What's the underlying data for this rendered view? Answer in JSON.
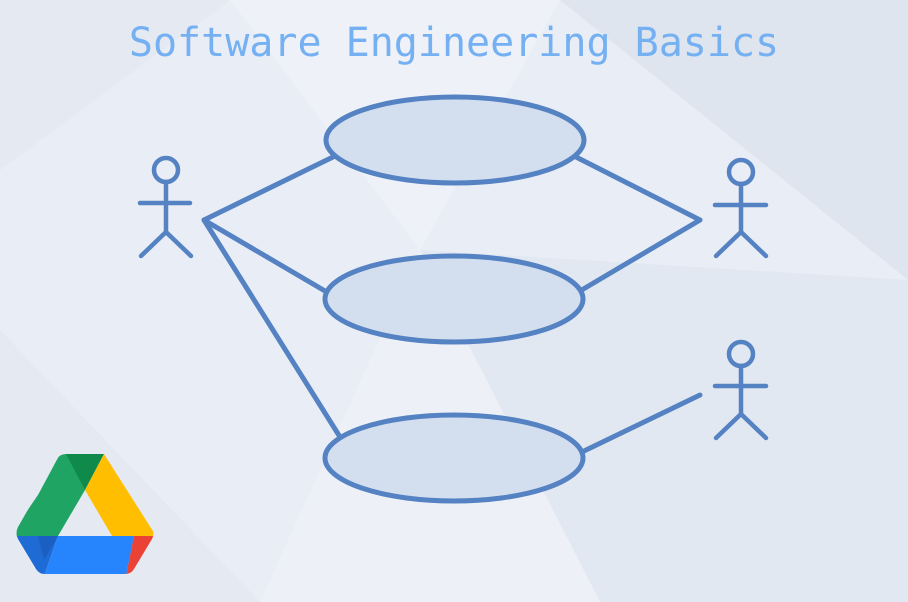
{
  "title": "Software Engineering Basics",
  "colors": {
    "background": "#e9edf5",
    "title": "#74b0f2",
    "stroke": "#5482c2",
    "ellipse_fill": "#d3deef"
  },
  "diagram": {
    "type": "use-case-diagram",
    "actors": [
      {
        "id": "actor-left",
        "label": ""
      },
      {
        "id": "actor-right-top",
        "label": ""
      },
      {
        "id": "actor-right-bottom",
        "label": ""
      }
    ],
    "use_cases": [
      {
        "id": "use-case-1",
        "label": ""
      },
      {
        "id": "use-case-2",
        "label": ""
      },
      {
        "id": "use-case-3",
        "label": ""
      }
    ],
    "associations": [
      [
        "actor-left",
        "use-case-1"
      ],
      [
        "actor-left",
        "use-case-2"
      ],
      [
        "actor-left",
        "use-case-3"
      ],
      [
        "actor-right-top",
        "use-case-1"
      ],
      [
        "actor-right-top",
        "use-case-2"
      ],
      [
        "actor-right-bottom",
        "use-case-3"
      ]
    ]
  },
  "logo": {
    "icon": "google-drive-icon"
  }
}
